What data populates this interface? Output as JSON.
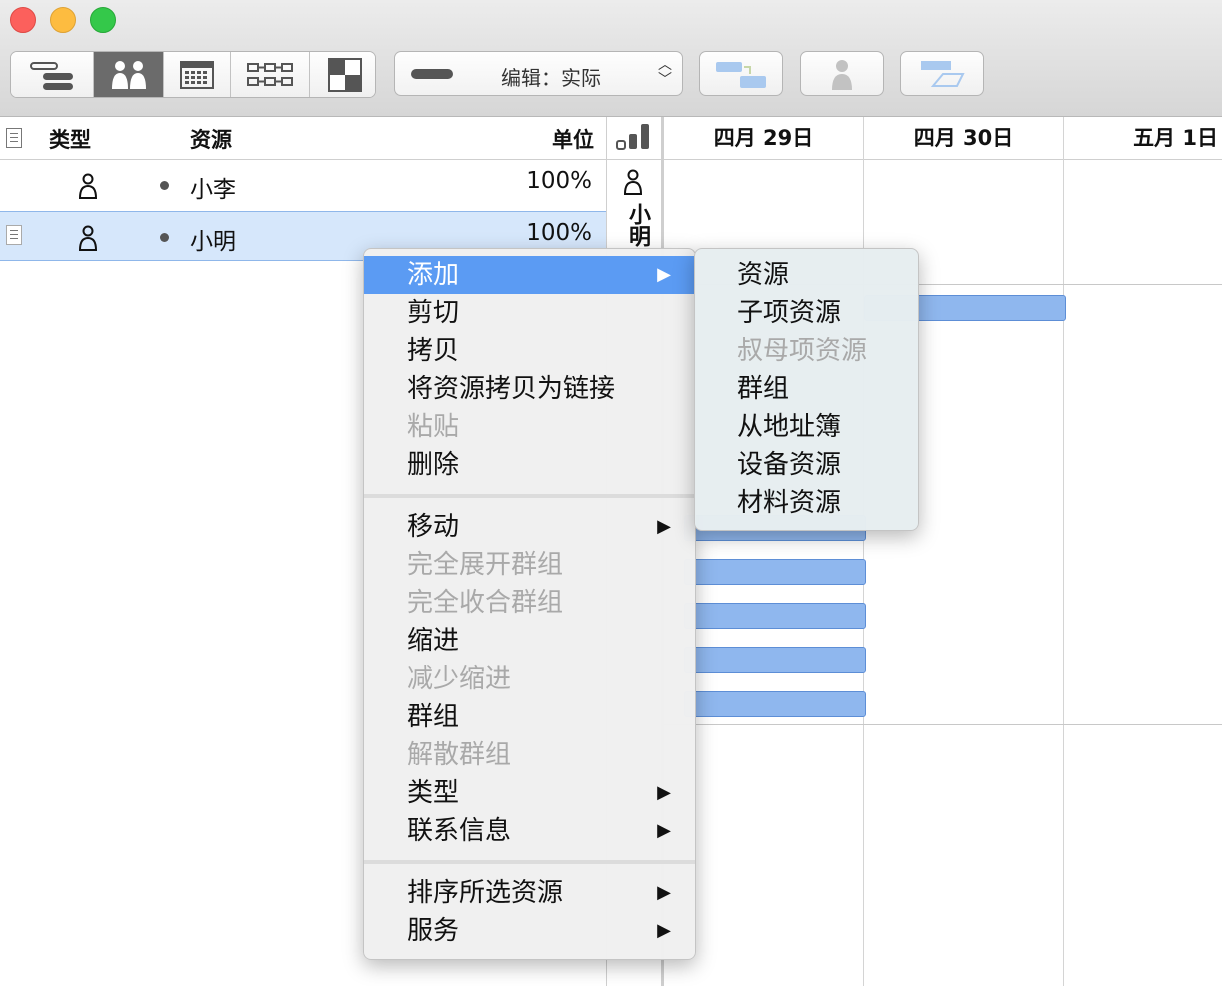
{
  "window": {
    "controls": [
      "close",
      "minimize",
      "zoom"
    ]
  },
  "toolbar": {
    "view_modes": [
      {
        "icon": "gantt-outline-icon",
        "active": false
      },
      {
        "icon": "resources-view-icon",
        "active": true
      },
      {
        "icon": "calendar-view-icon",
        "active": false
      },
      {
        "icon": "network-view-icon",
        "active": false
      },
      {
        "icon": "styles-view-icon",
        "active": false
      }
    ],
    "edit_mode_label": "编辑：实际",
    "buttons": [
      "connect-tasks-icon",
      "assign-resource-icon",
      "task-bar-icon"
    ]
  },
  "outline": {
    "columns": {
      "type": "类型",
      "resource": "资源",
      "units": "单位"
    },
    "rows": [
      {
        "name": "小李",
        "units": "100%",
        "selected": false
      },
      {
        "name": "小明",
        "units": "100%",
        "selected": true
      }
    ],
    "divider_label": "小明"
  },
  "gantt": {
    "dates": [
      "四月 29日",
      "四月 30日",
      "五月 1日"
    ]
  },
  "context_menu": {
    "items": [
      {
        "label": "添加",
        "submenu": true,
        "highlighted": true,
        "enabled": true
      },
      {
        "label": "剪切",
        "enabled": true
      },
      {
        "label": "拷贝",
        "enabled": true
      },
      {
        "label": "将资源拷贝为链接",
        "enabled": true
      },
      {
        "label": "粘贴",
        "enabled": false
      },
      {
        "label": "删除",
        "enabled": true
      },
      {
        "separator": true
      },
      {
        "label": "移动",
        "submenu": true,
        "enabled": true
      },
      {
        "label": "完全展开群组",
        "enabled": false
      },
      {
        "label": "完全收合群组",
        "enabled": false
      },
      {
        "label": "缩进",
        "enabled": true
      },
      {
        "label": "减少缩进",
        "enabled": false
      },
      {
        "label": "群组",
        "enabled": true
      },
      {
        "label": "解散群组",
        "enabled": false
      },
      {
        "label": "类型",
        "submenu": true,
        "enabled": true
      },
      {
        "label": "联系信息",
        "submenu": true,
        "enabled": true
      },
      {
        "separator": true
      },
      {
        "label": "排序所选资源",
        "submenu": true,
        "enabled": true
      },
      {
        "label": "服务",
        "submenu": true,
        "enabled": true
      }
    ]
  },
  "add_submenu": {
    "items": [
      {
        "label": "资源",
        "enabled": true
      },
      {
        "label": "子项资源",
        "enabled": true
      },
      {
        "label": "叔母项资源",
        "enabled": false
      },
      {
        "label": "群组",
        "enabled": true
      },
      {
        "label": "从地址簿",
        "enabled": true
      },
      {
        "label": "设备资源",
        "enabled": true
      },
      {
        "label": "材料资源",
        "enabled": true
      }
    ]
  },
  "colors": {
    "highlight": "#5b9bf3",
    "bar": "#8fb7ee",
    "selected_row": "#d6e7fb"
  }
}
